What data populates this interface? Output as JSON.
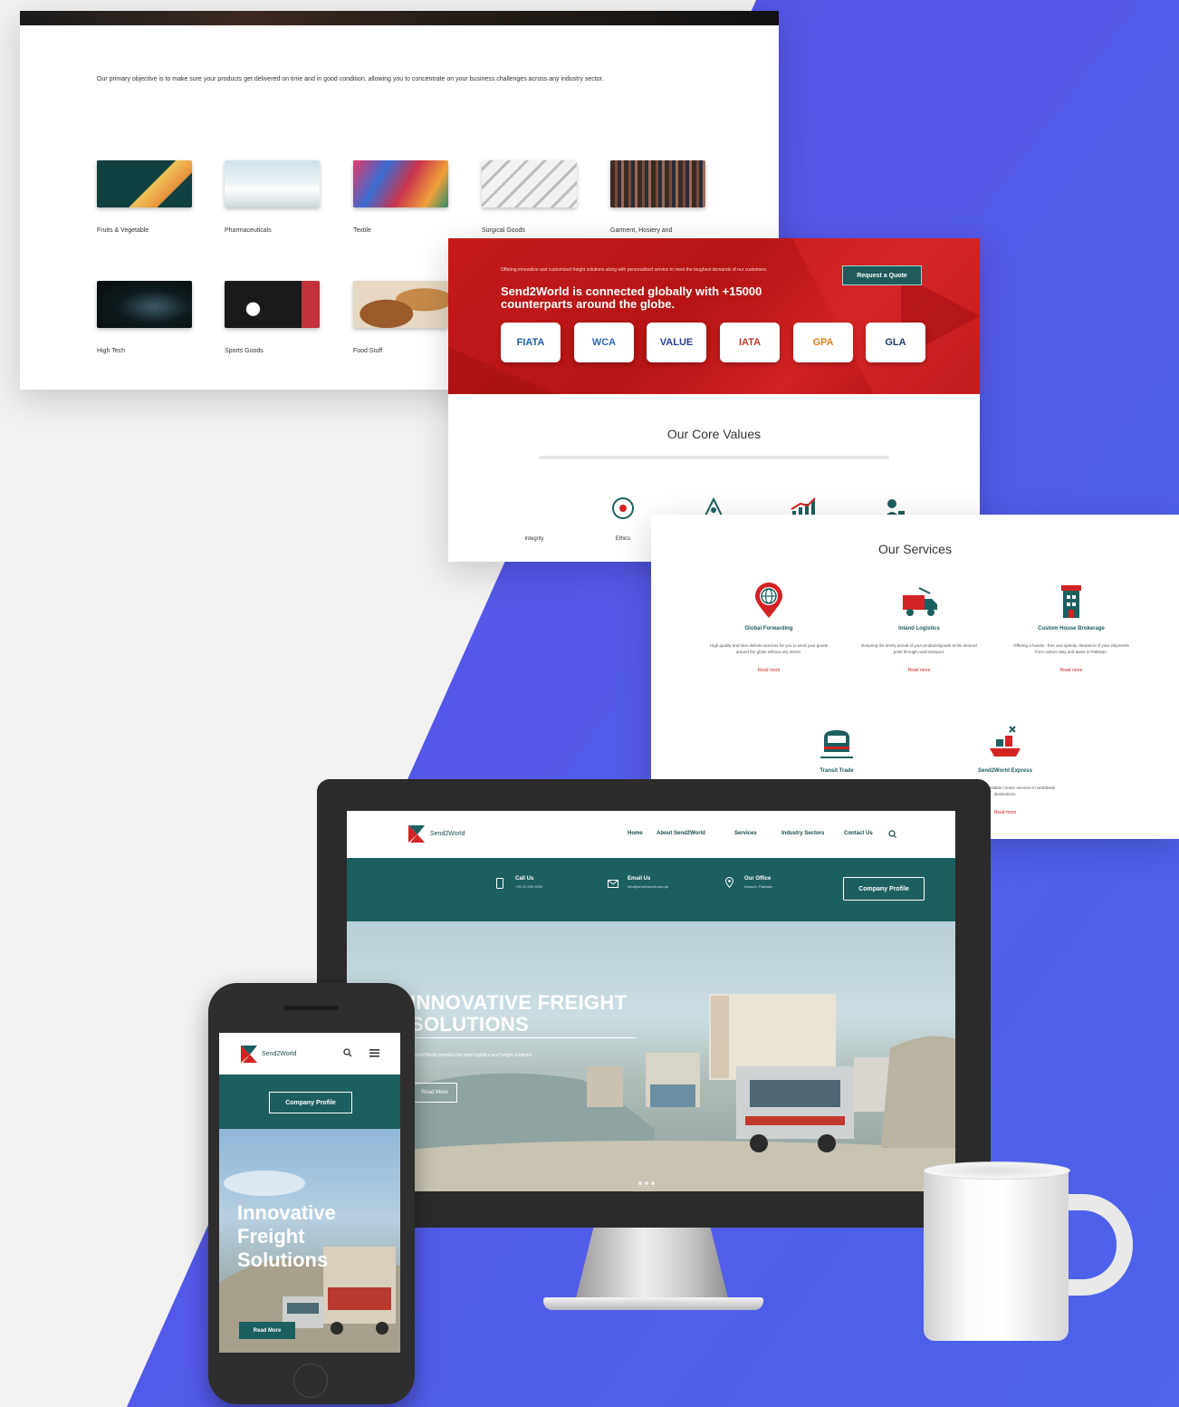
{
  "industries": {
    "intro": "Our primary objective is to make sure your products get delivered on time and in good condition, allowing you to concentrate on your business challenges across any industry sector.",
    "items": [
      {
        "label": "Fruits & Vegetable",
        "color": "#0f3f3f"
      },
      {
        "label": "Pharmaceuticals",
        "color": "#d9e8ef"
      },
      {
        "label": "Textile",
        "color": "#c9354d"
      },
      {
        "label": "Surgical Goods",
        "color": "#dcdcdc"
      },
      {
        "label": "Garment, Hosiery and",
        "color": "#4a3a33"
      },
      {
        "label": "High Tech",
        "color": "#0e1a1d"
      },
      {
        "label": "Sports Goods",
        "color": "#1a1a1a"
      },
      {
        "label": "Food Stuff",
        "color": "#b27a44"
      }
    ]
  },
  "partners": {
    "lead": "Offering innovative and customized freight solutions along with personalized service to meet the toughest demands of our customers.",
    "headline": "Send2World is connected globally with +15000 counterparts around the globe.",
    "quote_button": "Request a Quote",
    "logos": [
      "FIATA",
      "WCA",
      "VALUE",
      "IATA",
      "GPA",
      "GLA"
    ]
  },
  "core_values": {
    "title": "Our Core Values",
    "items": [
      {
        "label": "Integrity",
        "icon": "shield-icon"
      },
      {
        "label": "Ethics",
        "icon": "target-icon"
      },
      {
        "label": "",
        "icon": "network-icon"
      },
      {
        "label": "",
        "icon": "growth-chart-icon"
      },
      {
        "label": "",
        "icon": "person-icon"
      }
    ]
  },
  "services": {
    "title": "Our Services",
    "items": [
      {
        "name": "Global Forwarding",
        "desc": "High quality and time definite services for you to send your goods around the globe without any stress.",
        "more": "Read more",
        "icon": "globe-pin-icon"
      },
      {
        "name": "Inland Logistics",
        "desc": "Ensuring the timely arrival of your products/goods at the desired point through road transport.",
        "more": "Read more",
        "icon": "truck-icon"
      },
      {
        "name": "Custom House Brokerage",
        "desc": "Offering a hassle - free and speedy clearance of your shipments from custom duty and taxes in Pakistan.",
        "more": "Read more",
        "icon": "building-icon"
      },
      {
        "name": "Transit Trade",
        "desc": "",
        "more": "",
        "icon": "train-icon"
      },
      {
        "name": "Send2World Express",
        "desc": "Fast, efficient and reliable courier services to worldwide destinations.",
        "more": "Read more",
        "icon": "ship-icon"
      }
    ]
  },
  "desktop": {
    "brand": "Send2World",
    "nav": [
      "Home",
      "About Send2World",
      "Services",
      "Industry Sectors",
      "Contact Us"
    ],
    "info": [
      {
        "title": "Call Us",
        "value": "+92 21 000 0000",
        "icon": "phone-icon"
      },
      {
        "title": "Email Us",
        "value": "info@send2world.com.pk",
        "icon": "mail-icon"
      },
      {
        "title": "Our Office",
        "value": "Karachi, Pakistan",
        "icon": "location-icon"
      }
    ],
    "company_profile": "Company Profile",
    "hero_title_line1": "INNOVATIVE FREIGHT",
    "hero_title_line2": "SOLUTIONS",
    "hero_sub": "Send2World provides the best logistics and freight solutions.",
    "hero_button": "Read More"
  },
  "phone": {
    "brand": "Send2World",
    "company_profile": "Company Profile",
    "hero_line1": "Innovative",
    "hero_line2": "Freight",
    "hero_line3": "Solutions",
    "read_more": "Read More"
  },
  "colors": {
    "accent_teal": "#1c5f5f",
    "accent_red": "#c51a1a",
    "bg_blue": "#5a5fe8"
  }
}
